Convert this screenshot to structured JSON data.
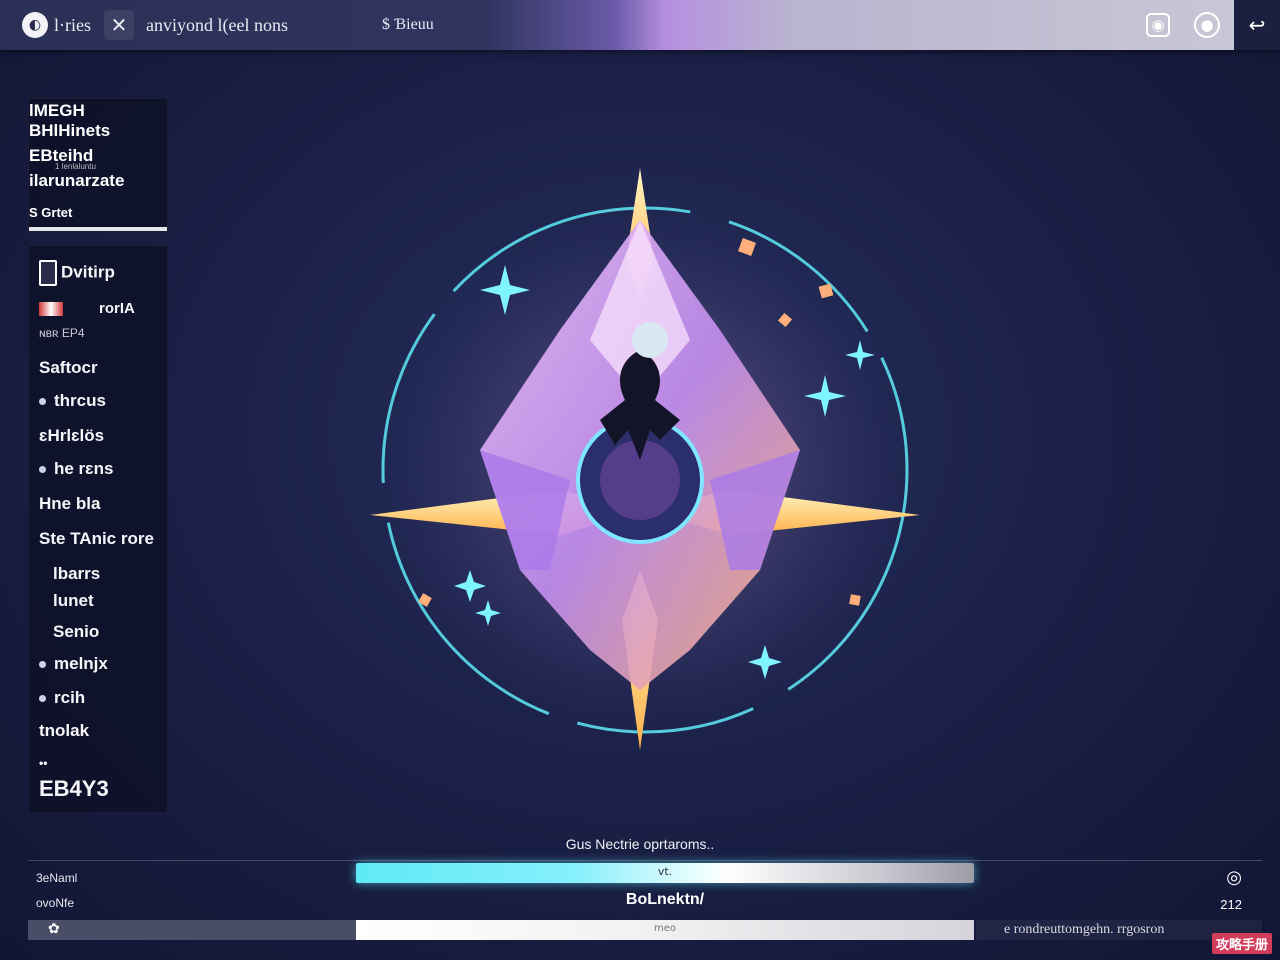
{
  "topbar": {
    "logo_glyph": "⬤",
    "app_label": "l·ries",
    "close_glyph": "✕",
    "window_title": "anviyond l(eel nons",
    "status_text": "$ Ɓieuu",
    "icons": [
      "camera-icon",
      "record-icon",
      "exit-icon"
    ]
  },
  "info_panel": {
    "lines": [
      "lMEGH",
      "BHlHinets",
      "EBteihd",
      "ilarunarzate"
    ],
    "tiny_line": "1 lenlaluntu",
    "footer": "S Grtet"
  },
  "menu": {
    "header": "Dvitirp",
    "status_line": "rorIA",
    "sub_line": "ɴʙʀ EP4",
    "items": [
      {
        "label": "Saftocr",
        "dot": false,
        "indent": false
      },
      {
        "label": "thrcus",
        "dot": true,
        "indent": false
      },
      {
        "label": "ɛHrlɛlös",
        "dot": false,
        "indent": false
      },
      {
        "label": "he rɛns",
        "dot": true,
        "indent": false
      },
      {
        "label": "Hne bla",
        "dot": false,
        "indent": false
      },
      {
        "label": "Ste TAnic rore",
        "dot": false,
        "indent": false
      },
      {
        "label": "lbarrs",
        "dot": false,
        "indent": true
      },
      {
        "label": "lunet",
        "dot": false,
        "indent": true
      },
      {
        "label": "Senio",
        "dot": false,
        "indent": true
      },
      {
        "label": "melnjx",
        "dot": true,
        "indent": false
      },
      {
        "label": "rcih",
        "dot": true,
        "indent": false
      },
      {
        "label": "tnolak",
        "dot": false,
        "indent": false
      }
    ],
    "footer_dots": "••",
    "footer_label": "EB4Y3"
  },
  "stage": {
    "caption": "Gus Nectrie oprtaroms.."
  },
  "bottom": {
    "row1_left": "3eNaml",
    "bar1_label": "vt.",
    "row1_right_icon": "eye-icon",
    "row2_left": "ovoNfe",
    "mid_label": "BoLnektn/",
    "row2_right": "212",
    "bar2_left_glyph": "✿",
    "bar2_label": "meo",
    "bar2_right_text": "e rondreuttomgehn. rrgosron"
  },
  "watermark": "攻略手册",
  "colors": {
    "accent_cyan": "#5fe9f7",
    "accent_violet": "#b58fe0",
    "background": "#1b2148",
    "accent_gold": "#ffd96b",
    "accent_pink": "#e59be0"
  }
}
